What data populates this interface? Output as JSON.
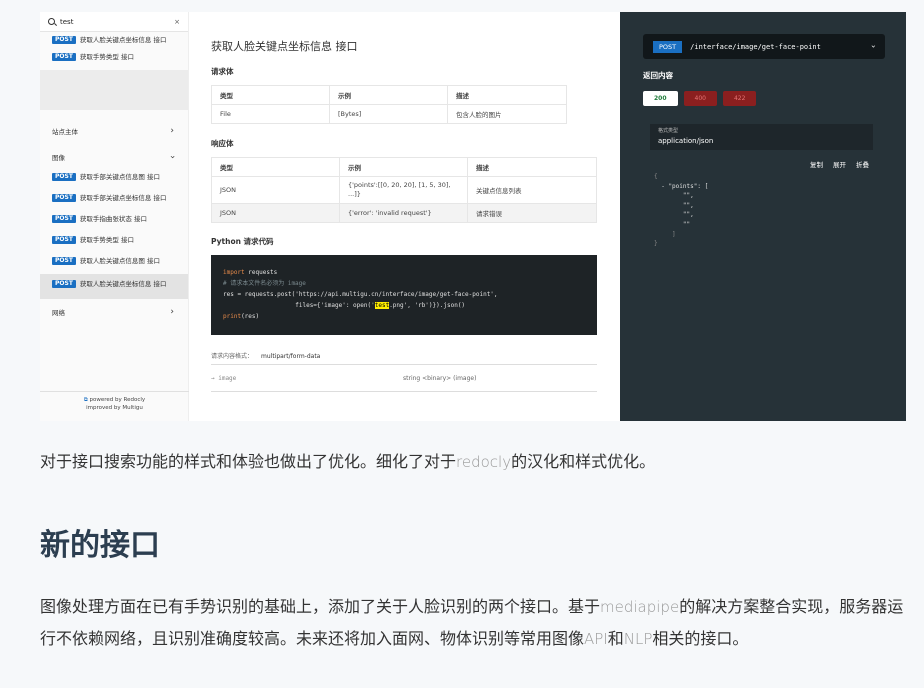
{
  "sidebar": {
    "search_value": "test",
    "clear": "×",
    "top_ops": [
      {
        "method": "POST",
        "label": "获取人脸关键点坐标信息 接口"
      },
      {
        "method": "POST",
        "label": "获取手势类型 接口"
      }
    ],
    "cat_station": "站点主体",
    "cat_image": "图像",
    "image_ops": [
      {
        "method": "POST",
        "label": "获取手部关键点信息图 接口"
      },
      {
        "method": "POST",
        "label": "获取手部关键点坐标信息 接口"
      },
      {
        "method": "POST",
        "label": "获取手指曲张状态 接口"
      },
      {
        "method": "POST",
        "label": "获取手势类型 接口"
      },
      {
        "method": "POST",
        "label": "获取人脸关键点信息图 接口"
      },
      {
        "method": "POST",
        "label": "获取人脸关键点坐标信息 接口"
      }
    ],
    "cat_net": "网络",
    "powered1": "powered by Redocly",
    "powered2": "improved by Multigu"
  },
  "main": {
    "title": "获取人脸关键点坐标信息 接口",
    "req_body": "请求体",
    "req_table": {
      "headers": [
        "类型",
        "示例",
        "描述"
      ],
      "rows": [
        [
          "File",
          "[Bytes]",
          "包含人脸的图片"
        ]
      ]
    },
    "resp_body": "响应体",
    "resp_table": {
      "headers": [
        "类型",
        "示例",
        "描述"
      ],
      "rows": [
        [
          "JSON",
          "{'points':[[0, 20, 20], [1, 5, 30], ...]}",
          "关键点信息列表"
        ],
        [
          "JSON",
          "{'error': 'invalid request'}",
          "请求错误"
        ]
      ]
    },
    "python_title": "Python 请求代码",
    "code": {
      "l1_kw": "import",
      "l1_rest": " requests",
      "l2": "# 请求本文件名必须为 image",
      "l3": "res = requests.post('https://api.multigu.cn/interface/image/get-face-point',",
      "l4_a": "                    files={'image': open(",
      "l4_b": "'",
      "l4_hl": "test",
      "l4_c": ".png', 'rb')}).json()",
      "l5_kw": "print",
      "l5_rest": "(res)"
    },
    "content_type_label": "请求内容格式：",
    "content_type_value": "multipart/form-data",
    "field_name": "→ image",
    "field_type": "string <binary> (image)"
  },
  "panel": {
    "method": "POST",
    "path": "/interface/image/get-face-point",
    "resp_title": "返回内容",
    "codes": [
      "200",
      "400",
      "422"
    ],
    "ctype_label": "格式类型",
    "ctype_value": "application/json",
    "actions": [
      "复制",
      "展开",
      "折叠"
    ],
    "json": {
      "l1": "{",
      "l2": "  - \"points\": [",
      "l3": "        \"\",",
      "l4": "        \"\",",
      "l5": "        \"\",",
      "l6": "        \"\"",
      "l7": "     ]",
      "l8": "}"
    }
  },
  "article": {
    "p1_a": "对于接口搜索功能的样式和体验也做出了优化。细化了对于",
    "p1_b": "redocly",
    "p1_c": "的汉化和样式优化。",
    "heading": "新的接口",
    "p2_a": "图像处理方面在已有手势识别的基础上，添加了关于人脸识别的两个接口。基于",
    "p2_b": "mediapipe",
    "p2_c": "的解决方案整合实现，服务器运行不依赖网络，且识别准确度较高。未来还将加入面网、物体识别等常用图像",
    "p2_d": "API",
    "p2_e": "和",
    "p2_f": "NLP",
    "p2_g": "相关的接口。"
  }
}
